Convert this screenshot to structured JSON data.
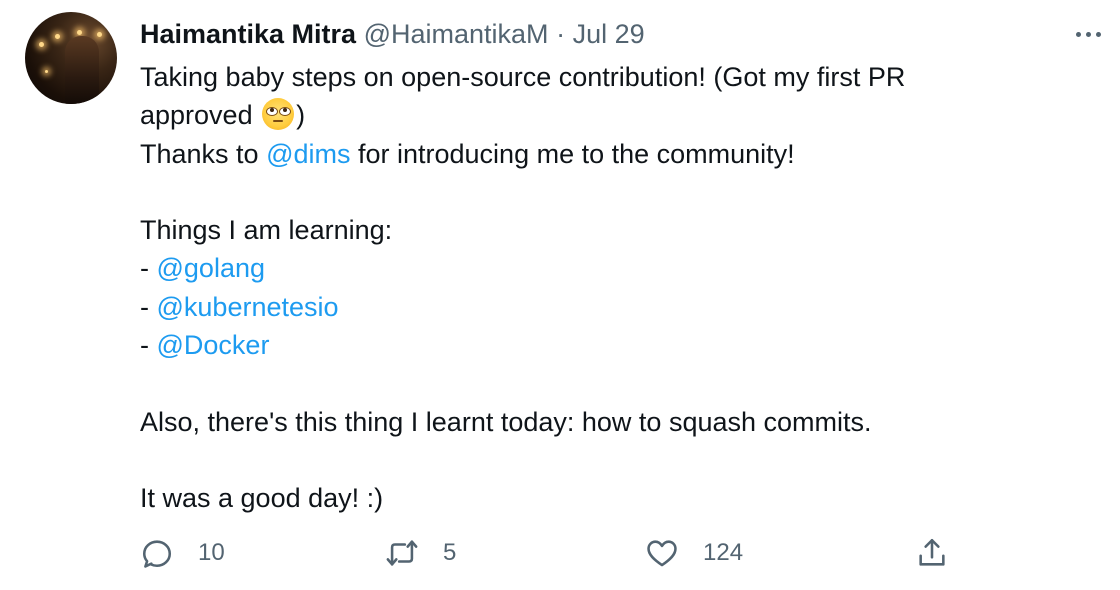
{
  "tweet": {
    "author_name": "Haimantika Mitra",
    "handle": "@HaimantikaM",
    "separator": "·",
    "date": "Jul 29",
    "lines": [
      [
        {
          "t": "Taking baby steps on open-source contribution! (Got my first PR"
        }
      ],
      [
        {
          "t": "approved "
        },
        {
          "emoji": "face-with-rolling-eyes"
        },
        {
          "t": ")"
        }
      ],
      [
        {
          "t": "Thanks to "
        },
        {
          "m": "@dims"
        },
        {
          "t": " for introducing me to the community!"
        }
      ],
      [],
      [
        {
          "t": "Things I am learning:"
        }
      ],
      [
        {
          "t": "- "
        },
        {
          "m": "@golang"
        }
      ],
      [
        {
          "t": "- "
        },
        {
          "m": "@kubernetesio"
        }
      ],
      [
        {
          "t": "- "
        },
        {
          "m": "@Docker"
        }
      ],
      [],
      [
        {
          "t": "Also, there's this thing I learnt today: how to squash commits."
        }
      ],
      [],
      [
        {
          "t": "It was a good day! :)"
        }
      ]
    ]
  },
  "actions": {
    "reply": {
      "icon": "reply-icon",
      "count": "10"
    },
    "retweet": {
      "icon": "retweet-icon",
      "count": "5"
    },
    "like": {
      "icon": "like-icon",
      "count": "124"
    },
    "share": {
      "icon": "share-icon"
    }
  },
  "colors": {
    "link": "#1d9bf0",
    "muted": "#536471",
    "text": "#0f1419"
  }
}
